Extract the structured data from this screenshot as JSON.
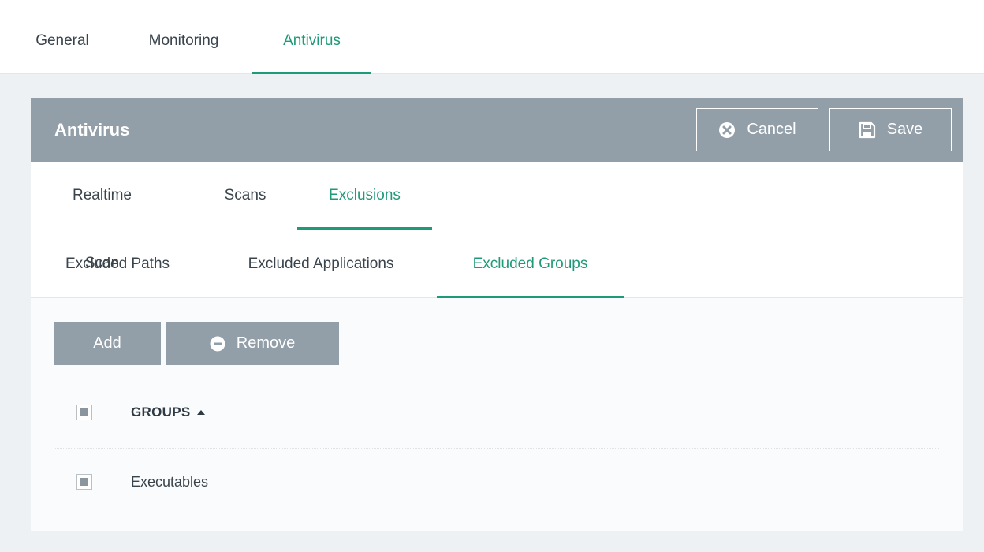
{
  "top_tabs": [
    {
      "label": "General"
    },
    {
      "label": "Monitoring"
    },
    {
      "label": "Antivirus"
    }
  ],
  "panel": {
    "title": "Antivirus",
    "cancel_label": "Cancel",
    "save_label": "Save"
  },
  "sub_tabs": [
    {
      "label": "Realtime Scan"
    },
    {
      "label": "Scans"
    },
    {
      "label": "Exclusions"
    }
  ],
  "exclusion_tabs": [
    {
      "label": "Excluded Paths"
    },
    {
      "label": "Excluded Applications"
    },
    {
      "label": "Excluded Groups"
    }
  ],
  "actions": {
    "add_label": "Add",
    "remove_label": "Remove"
  },
  "table": {
    "column_header": "GROUPS",
    "sort_direction": "ascending",
    "rows": [
      {
        "name": "Executables"
      }
    ]
  },
  "colors": {
    "accent": "#1f9a78",
    "header_bg": "#929ea8",
    "page_bg": "#eef1f4"
  },
  "icons": {
    "cancel": "x-circle-icon",
    "save": "floppy-disk-icon",
    "remove": "minus-circle-icon",
    "sort": "caret-up-icon"
  }
}
